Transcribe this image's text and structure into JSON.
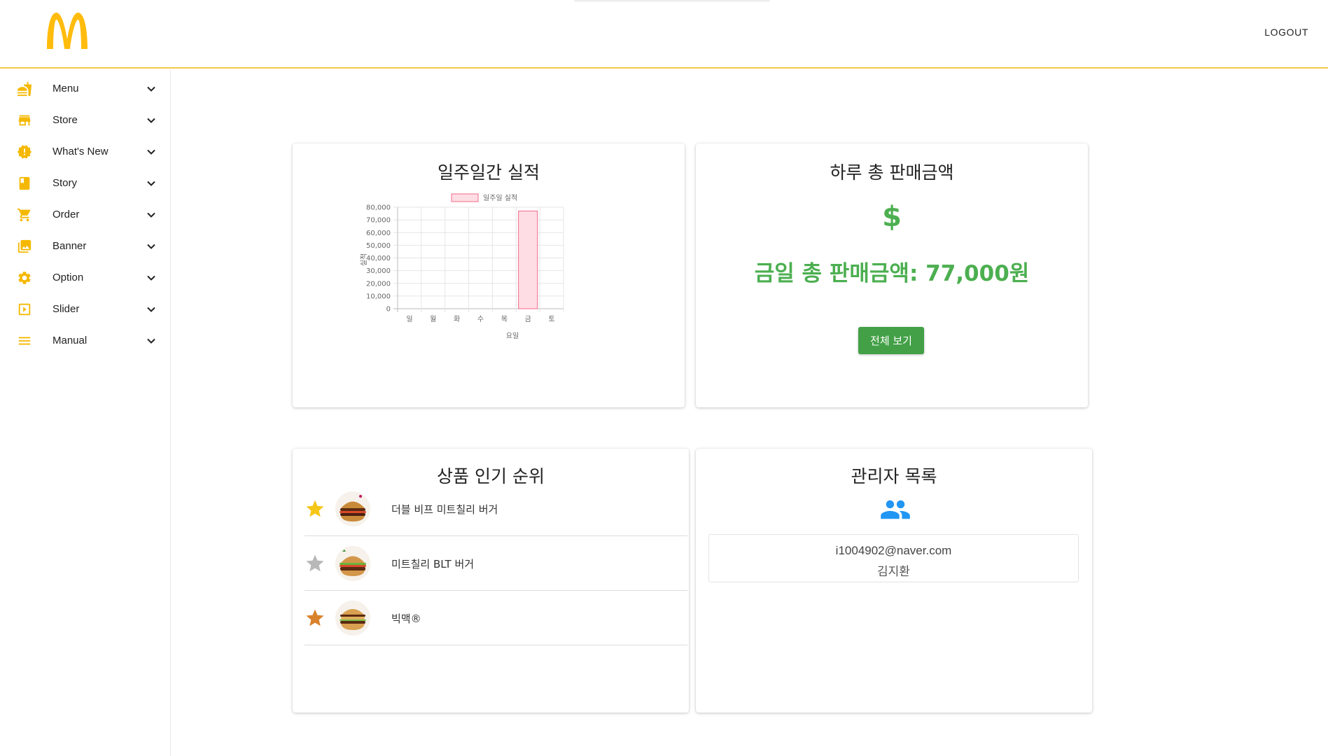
{
  "header": {
    "logo": "mcdonalds-golden-arches-logo",
    "logout_label": "LOGOUT",
    "border_color": "#f2c94c"
  },
  "sidebar": {
    "accent_color": "#f5b800",
    "items": [
      {
        "label": "Menu",
        "icon": "fastfood-icon"
      },
      {
        "label": "Store",
        "icon": "store-icon"
      },
      {
        "label": "What's New",
        "icon": "new-releases-icon"
      },
      {
        "label": "Story",
        "icon": "book-icon"
      },
      {
        "label": "Order",
        "icon": "cart-icon"
      },
      {
        "label": "Banner",
        "icon": "image-gallery-icon"
      },
      {
        "label": "Option",
        "icon": "gear-icon"
      },
      {
        "label": "Slider",
        "icon": "slideshow-icon"
      },
      {
        "label": "Manual",
        "icon": "hamburger-menu-icon"
      }
    ]
  },
  "weekly_card": {
    "title": "일주일간 실적"
  },
  "chart_data": {
    "type": "bar",
    "title": "",
    "legend": "일주일 실적",
    "legend_position": "top",
    "xlabel": "요일",
    "ylabel": "실적",
    "categories": [
      "일",
      "월",
      "화",
      "수",
      "목",
      "금",
      "토"
    ],
    "values": [
      0,
      0,
      0,
      0,
      0,
      77000,
      0
    ],
    "ylim": [
      0,
      80000
    ],
    "yticks": [
      "0",
      "10,000",
      "20,000",
      "30,000",
      "40,000",
      "50,000",
      "60,000",
      "70,000",
      "80,000"
    ],
    "grid": true,
    "bar_fill": "#ffdde4",
    "bar_stroke": "#f06a8a"
  },
  "sales_card": {
    "title": "하루 총 판매금액",
    "currency_symbol": "$",
    "total_text": "금일 총 판매금액: 77,000원",
    "view_all_label": "전체 보기",
    "accent_color": "#4caf50"
  },
  "ranking_card": {
    "title": "상품 인기 순위",
    "items": [
      {
        "name": "더블 비프 미트칠리 버거",
        "medal": "gold-star-icon",
        "color": "#f5c518"
      },
      {
        "name": "미트칠리 BLT 버거",
        "medal": "silver-star-icon",
        "color": "#b8b8b8"
      },
      {
        "name": "빅맥®",
        "medal": "bronze-star-icon",
        "color": "#d9822b"
      }
    ]
  },
  "admin_card": {
    "title": "관리자 목록",
    "icon": "people-icon",
    "icon_color": "#2196f3",
    "admins": [
      {
        "email": "i1004902@naver.com",
        "name": "김지환"
      }
    ]
  }
}
